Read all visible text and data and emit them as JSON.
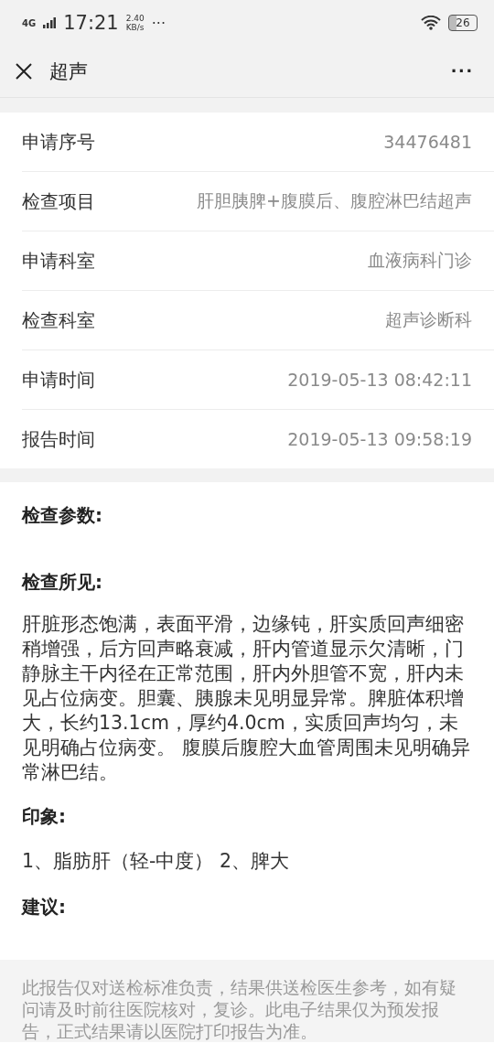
{
  "status_bar": {
    "network": "4G",
    "time": "17:21",
    "speed": "2.40",
    "speed_unit": "KB/s",
    "more": "···",
    "battery": "26"
  },
  "nav": {
    "title": "超声",
    "more": "···"
  },
  "details": [
    {
      "label": "申请序号",
      "value": "34476481"
    },
    {
      "label": "检查项目",
      "value": "肝胆胰脾+腹膜后、腹腔淋巴结超声"
    },
    {
      "label": "申请科室",
      "value": "血液病科门诊"
    },
    {
      "label": "检查科室",
      "value": "超声诊断科"
    },
    {
      "label": "申请时间",
      "value": "2019-05-13 08:42:11"
    },
    {
      "label": "报告时间",
      "value": "2019-05-13 09:58:19"
    }
  ],
  "sections": [
    {
      "heading": "检查参数:"
    },
    {
      "heading": "检查所见:",
      "body": "肝脏形态饱满，表面平滑，边缘钝，肝实质回声细密稍增强，后方回声略衰减，肝内管道显示欠清晰，门静脉主干内径在正常范围，肝内外胆管不宽，肝内未见占位病变。胆囊、胰腺未见明显异常。脾脏体积增大，长约13.1cm，厚约4.0cm，实质回声均匀，未见明确占位病变。 腹膜后腹腔大血管周围未见明确异常淋巴结。"
    },
    {
      "heading": "印象:",
      "body": "1、脂肪肝（轻-中度） 2、脾大"
    },
    {
      "heading": "建议:"
    }
  ],
  "disclaimer": "此报告仅对送检标准负责，结果供送检医生参考，如有疑问请及时前往医院核对，复诊。此电子结果仅为预发报告，正式结果请以医院打印报告为准。"
}
